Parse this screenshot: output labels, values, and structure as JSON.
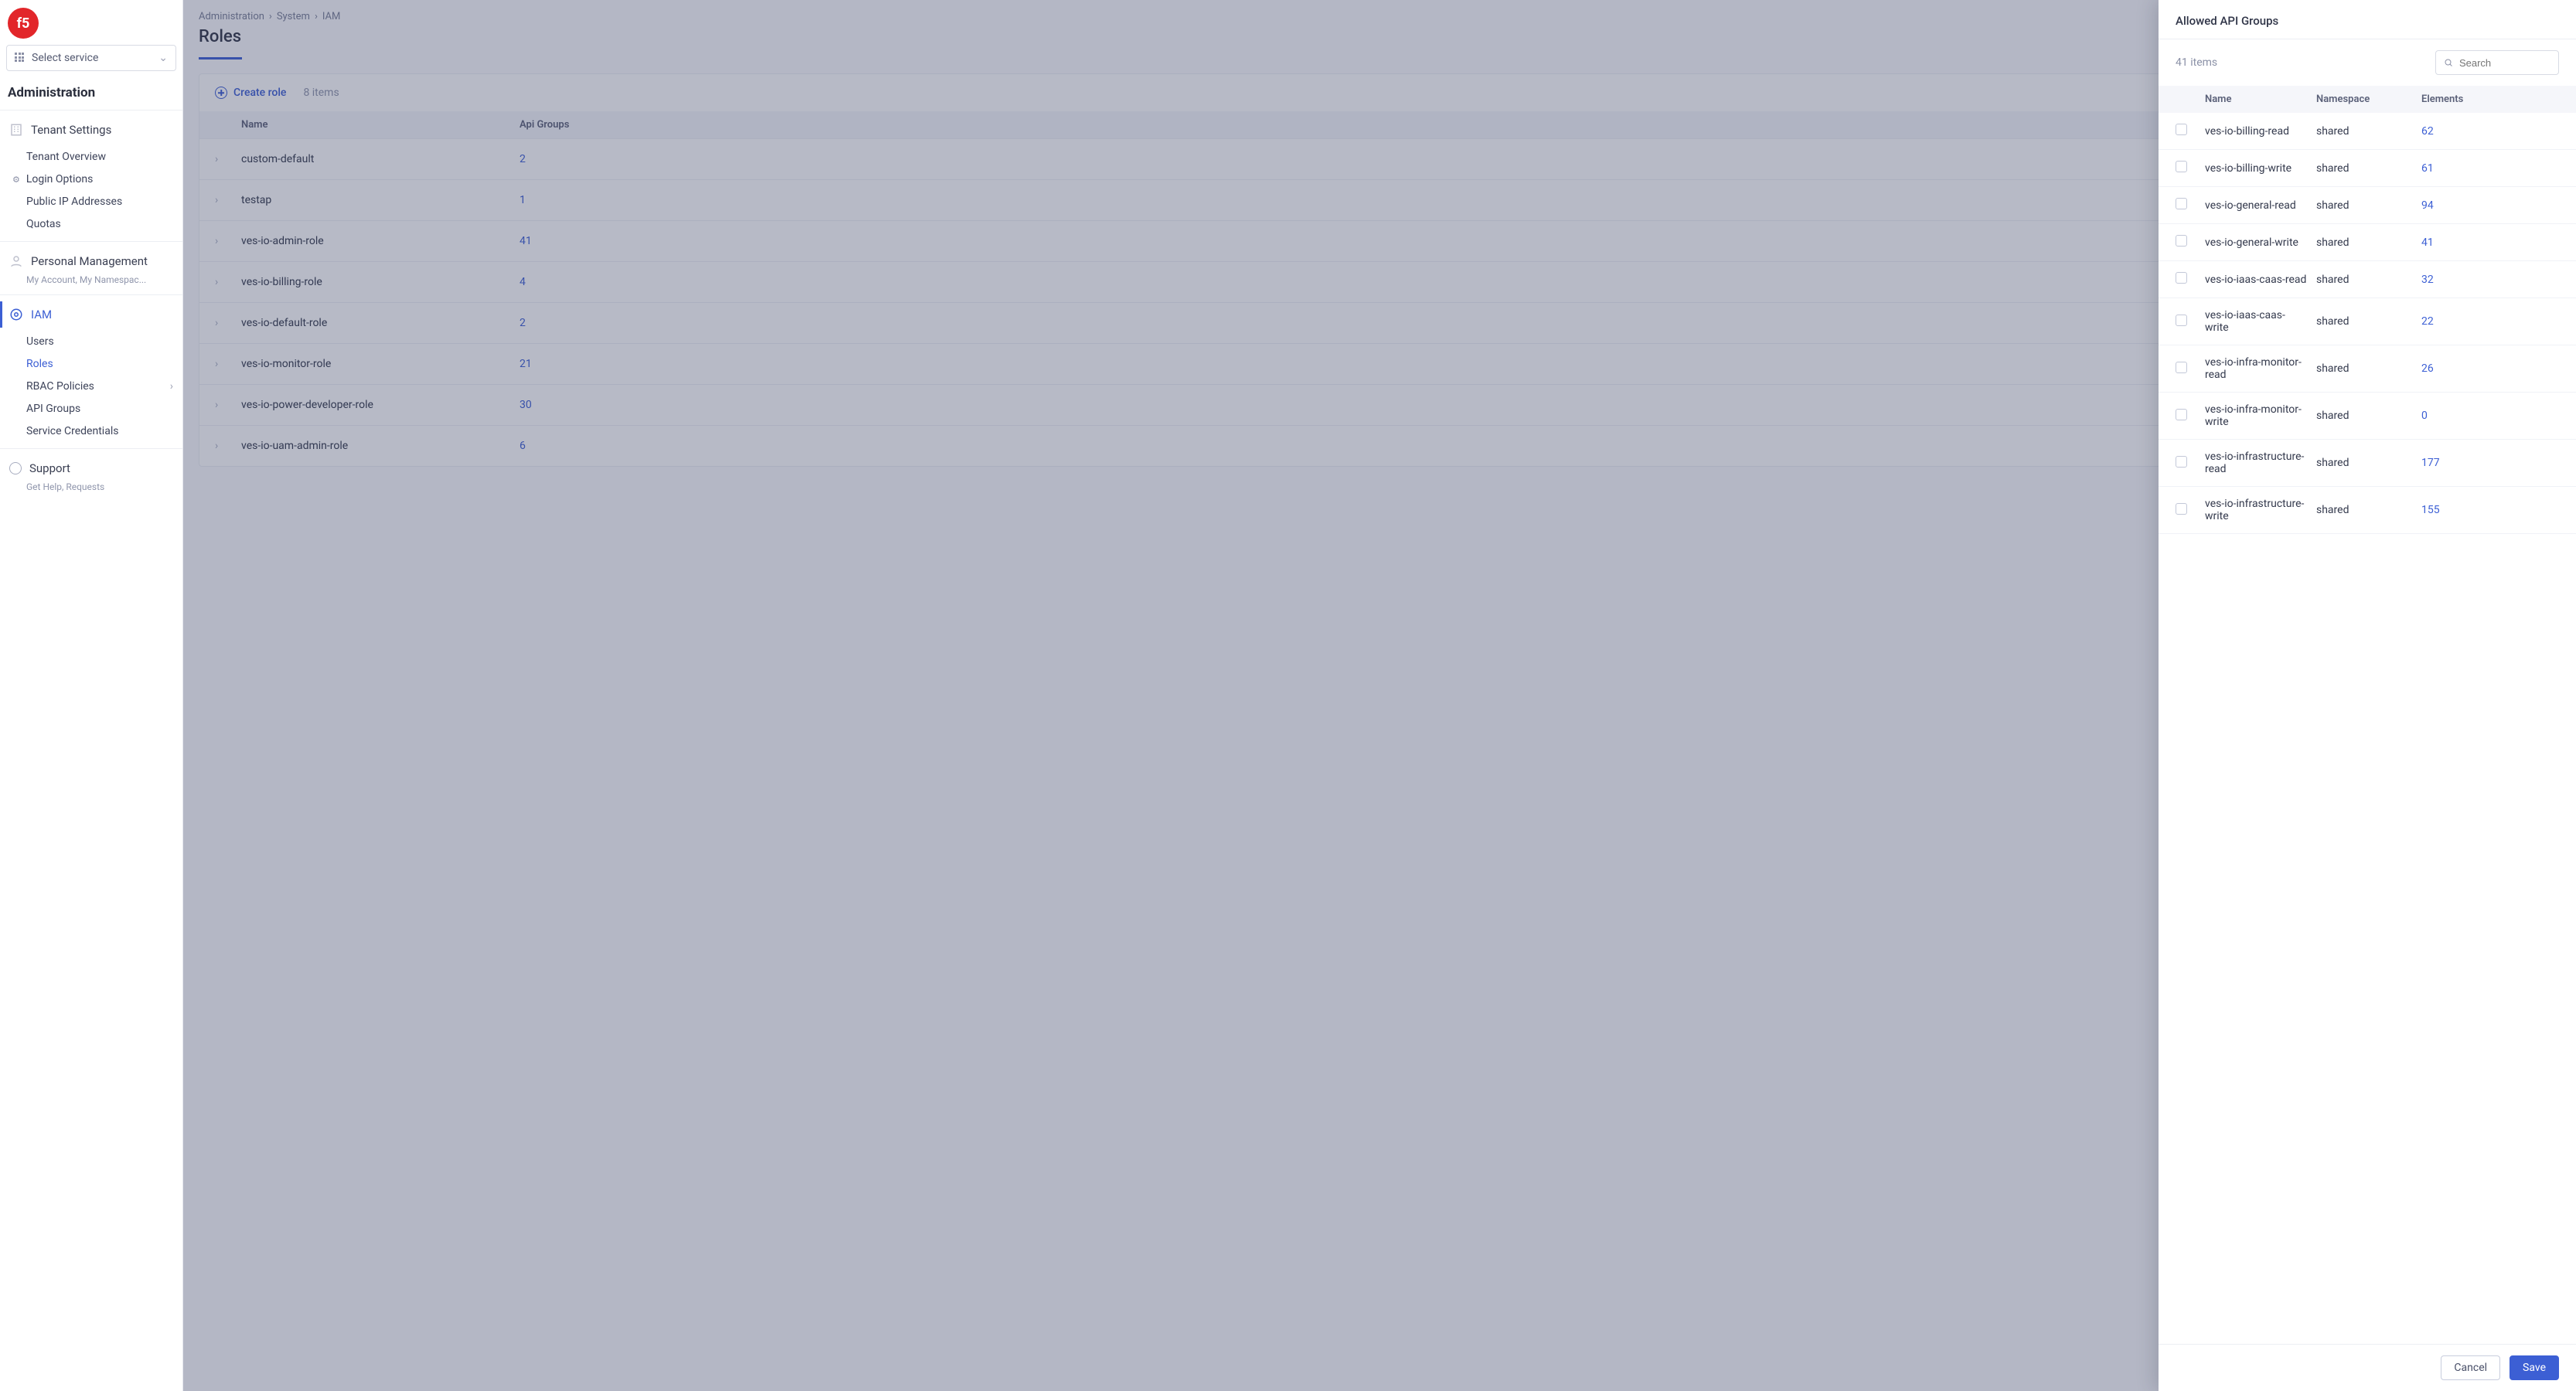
{
  "header": {
    "service_selector": "Select service",
    "section_title": "Administration"
  },
  "breadcrumb": [
    "Administration",
    "System",
    "IAM"
  ],
  "page_title": "Roles",
  "nav": {
    "tenant": {
      "label": "Tenant Settings",
      "items": [
        "Tenant Overview",
        "Login Options",
        "Public IP Addresses",
        "Quotas"
      ]
    },
    "personal": {
      "label": "Personal Management",
      "desc": "My Account, My Namespac..."
    },
    "iam": {
      "label": "IAM",
      "items": [
        "Users",
        "Roles",
        "RBAC Policies",
        "API Groups",
        "Service Credentials"
      ],
      "selected": "Roles",
      "expandable": "RBAC Policies"
    },
    "support": {
      "label": "Support",
      "desc": "Get Help, Requests"
    }
  },
  "roles_card": {
    "create_label": "Create role",
    "count_label": "8 items",
    "columns": {
      "name": "Name",
      "api": "Api Groups"
    },
    "rows": [
      {
        "name": "custom-default",
        "api": "2"
      },
      {
        "name": "testap",
        "api": "1"
      },
      {
        "name": "ves-io-admin-role",
        "api": "41"
      },
      {
        "name": "ves-io-billing-role",
        "api": "4"
      },
      {
        "name": "ves-io-default-role",
        "api": "2"
      },
      {
        "name": "ves-io-monitor-role",
        "api": "21"
      },
      {
        "name": "ves-io-power-developer-role",
        "api": "30"
      },
      {
        "name": "ves-io-uam-admin-role",
        "api": "6"
      }
    ]
  },
  "drawer": {
    "title": "Allowed API Groups",
    "count_label": "41 items",
    "search_placeholder": "Search",
    "columns": {
      "name": "Name",
      "ns": "Namespace",
      "el": "Elements"
    },
    "rows": [
      {
        "name": "ves-io-billing-read",
        "ns": "shared",
        "el": "62"
      },
      {
        "name": "ves-io-billing-write",
        "ns": "shared",
        "el": "61"
      },
      {
        "name": "ves-io-general-read",
        "ns": "shared",
        "el": "94"
      },
      {
        "name": "ves-io-general-write",
        "ns": "shared",
        "el": "41"
      },
      {
        "name": "ves-io-iaas-caas-read",
        "ns": "shared",
        "el": "32"
      },
      {
        "name": "ves-io-iaas-caas-write",
        "ns": "shared",
        "el": "22"
      },
      {
        "name": "ves-io-infra-monitor-read",
        "ns": "shared",
        "el": "26"
      },
      {
        "name": "ves-io-infra-monitor-write",
        "ns": "shared",
        "el": "0"
      },
      {
        "name": "ves-io-infrastructure-read",
        "ns": "shared",
        "el": "177"
      },
      {
        "name": "ves-io-infrastructure-write",
        "ns": "shared",
        "el": "155"
      }
    ],
    "cancel_label": "Cancel",
    "save_label": "Save"
  }
}
